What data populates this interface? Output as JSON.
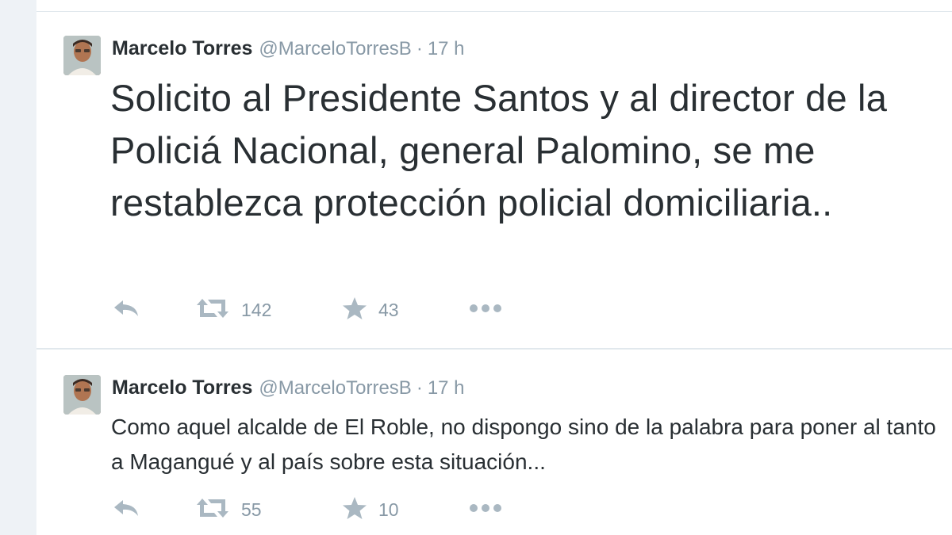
{
  "tweets": [
    {
      "author": {
        "name": "Marcelo Torres",
        "handle": "@MarceloTorresB",
        "avatar_icon": "profile-photo"
      },
      "separator": "·",
      "time": "17 h",
      "text": "Solicito  al Presidente Santos y al director de la Policiá Nacional, general Palomino, se me restablezca protección policial domiciliaria..",
      "actions": {
        "reply_icon": "reply-icon",
        "retweet_icon": "retweet-icon",
        "retweet_count": "142",
        "favorite_icon": "star-icon",
        "favorite_count": "43",
        "more_icon": "more-dots-icon"
      }
    },
    {
      "author": {
        "name": "Marcelo Torres",
        "handle": "@MarceloTorresB",
        "avatar_icon": "profile-photo"
      },
      "separator": "·",
      "time": "17 h",
      "text": "Como aquel alcalde de El Roble, no dispongo sino de la palabra para poner al tanto a Magangué y al país sobre esta situación...",
      "actions": {
        "reply_icon": "reply-icon",
        "retweet_icon": "retweet-icon",
        "retweet_count": "55",
        "favorite_icon": "star-icon",
        "favorite_count": "10",
        "more_icon": "more-dots-icon"
      }
    }
  ],
  "colors": {
    "text": "#292f33",
    "secondary": "#8899a6",
    "icon": "#aab8c2",
    "divider": "#e1e8ed",
    "gutter": "#eef2f6"
  }
}
